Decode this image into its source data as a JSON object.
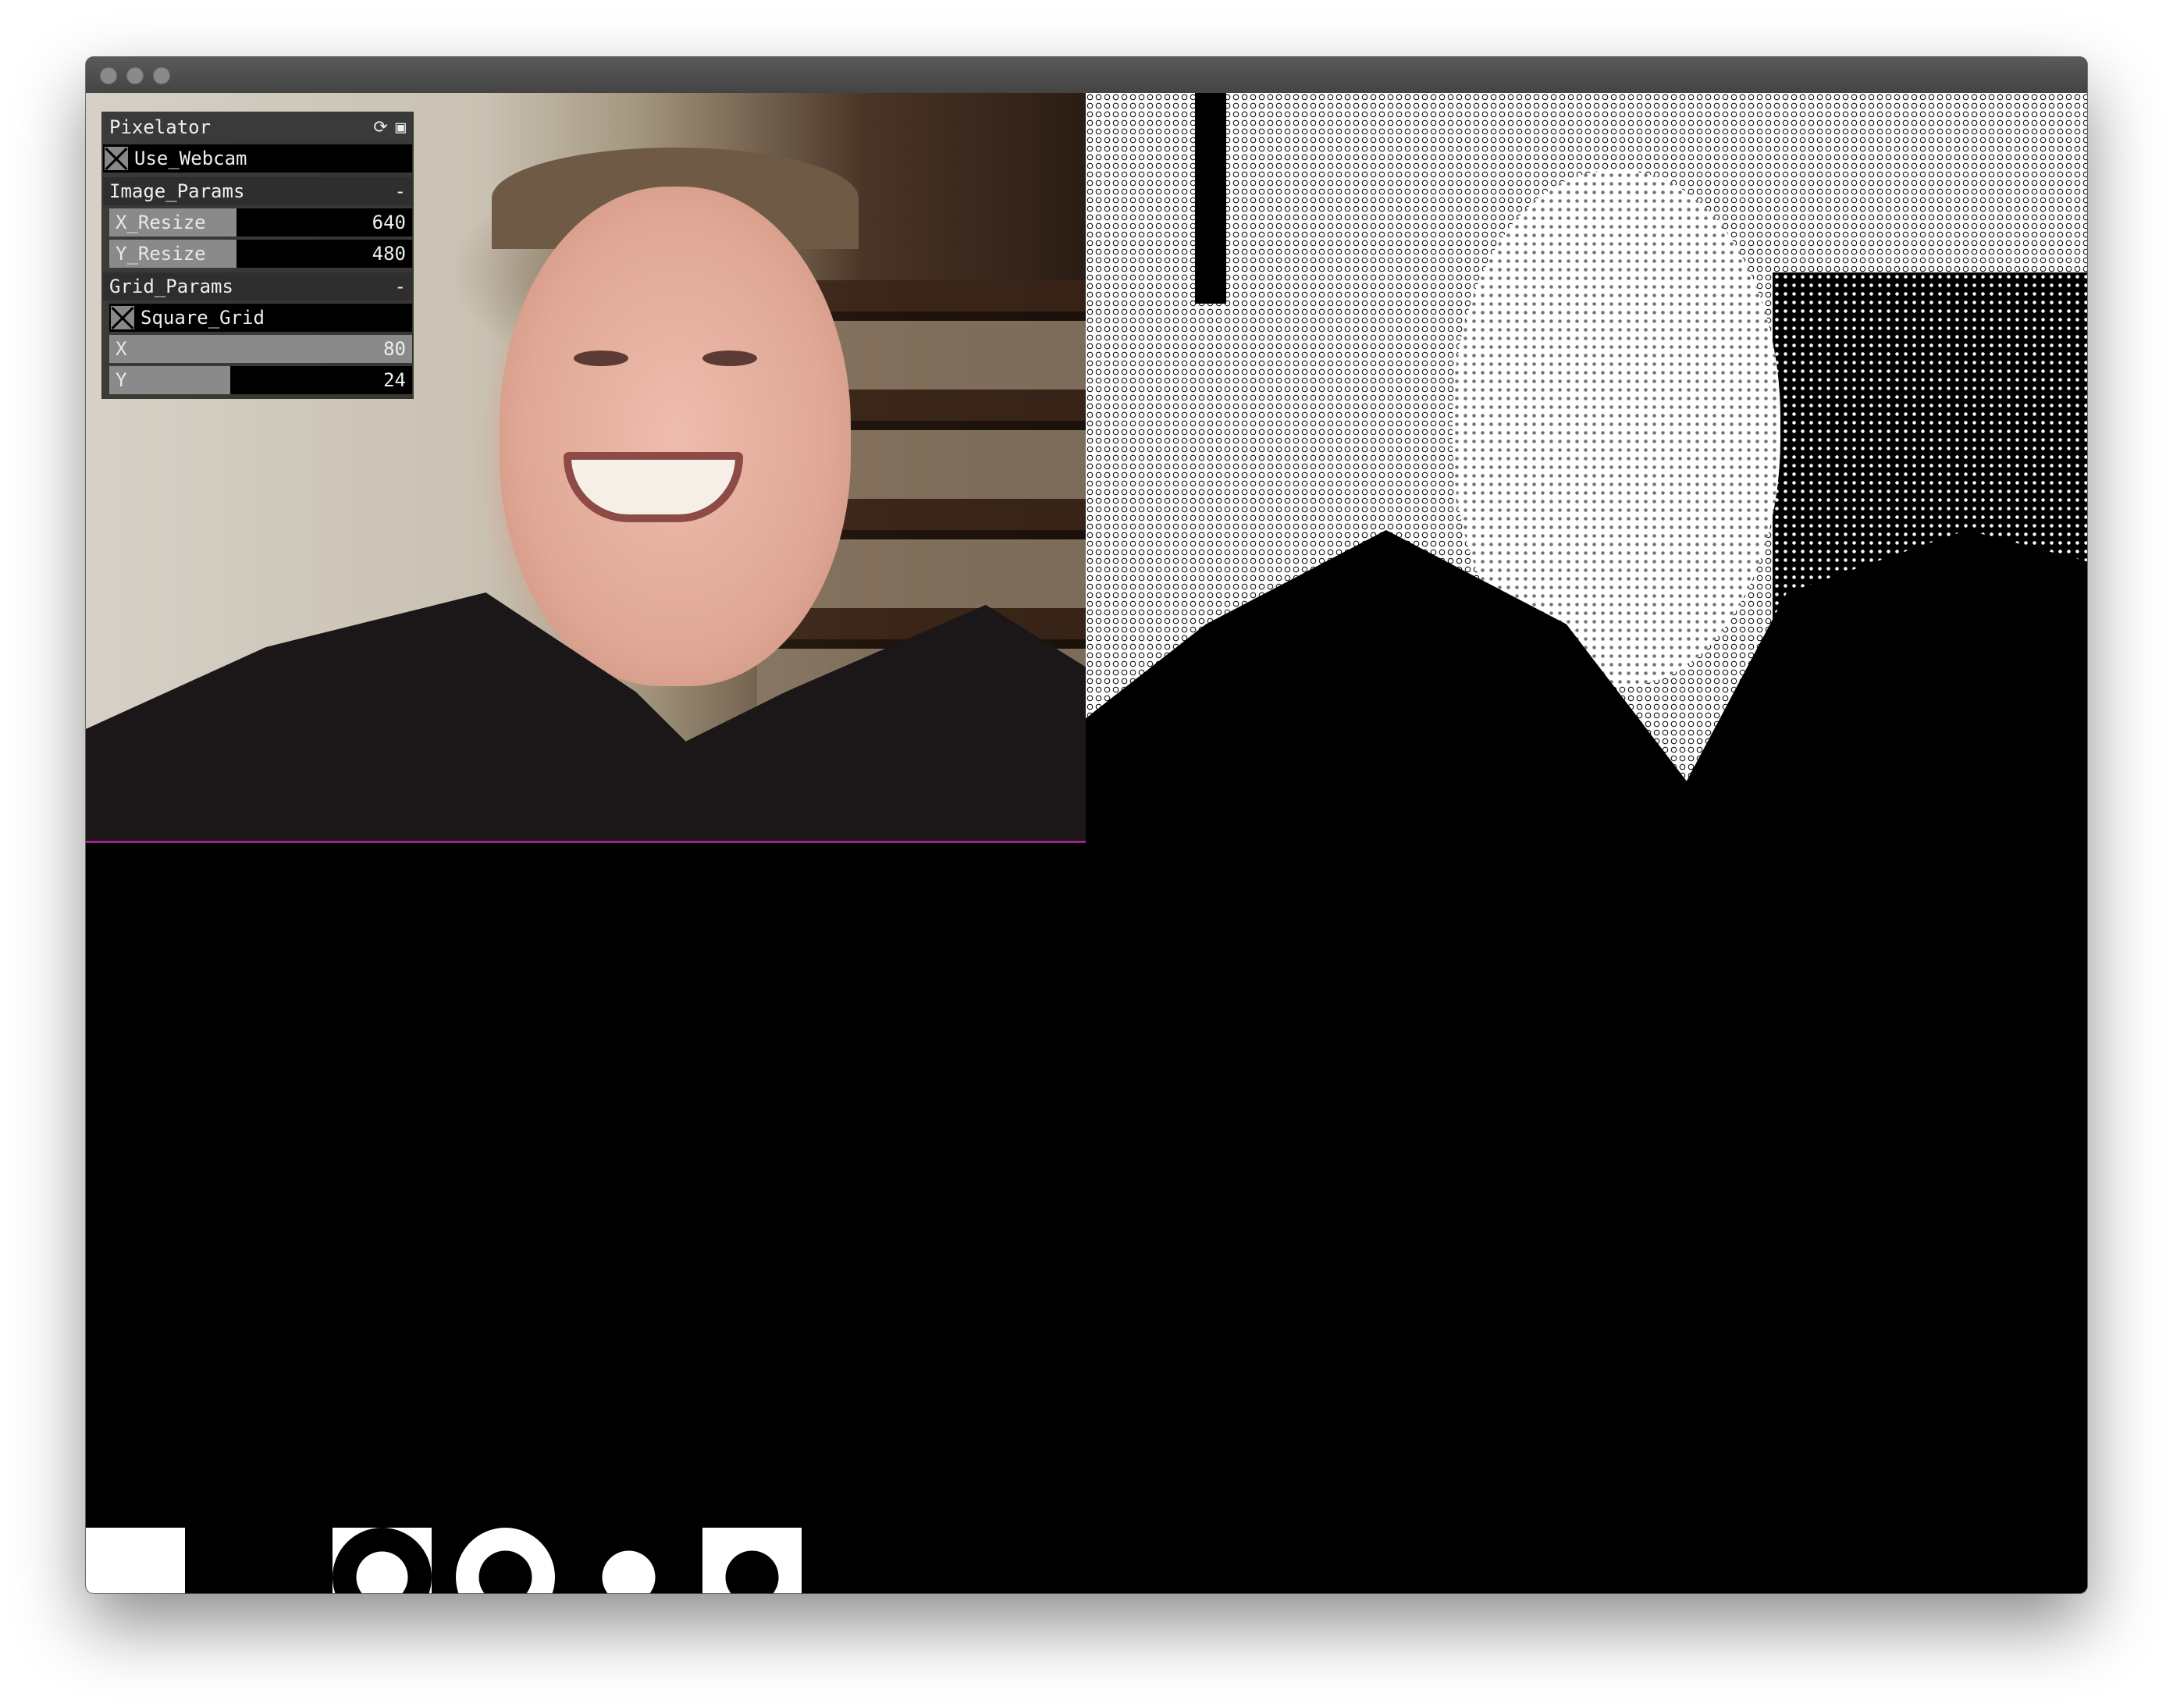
{
  "panel": {
    "title": "Pixelator",
    "refresh_icon": "⟳",
    "save_icon": "▣",
    "use_webcam_label": "Use_Webcam",
    "image_params": {
      "title": "Image_Params",
      "collapse": "-",
      "x_resize_label": "X_Resize",
      "x_resize_value": "640",
      "x_resize_fraction": 0.42,
      "y_resize_label": "Y_Resize",
      "y_resize_value": "480",
      "y_resize_fraction": 0.42
    },
    "grid_params": {
      "title": "Grid_Params",
      "collapse": "-",
      "square_grid_label": "Square_Grid",
      "x_label": "X",
      "x_value": "80",
      "x_fraction": 1.0,
      "y_label": "Y",
      "y_value": "24",
      "y_fraction": 0.4
    }
  },
  "colors": {
    "accent_line": "#a0208f",
    "panel_header": "#3a3a3a",
    "slider_fill": "#8a8a8a"
  },
  "icons": [
    "refresh-icon",
    "save-icon",
    "checkbox-cross-icon"
  ]
}
